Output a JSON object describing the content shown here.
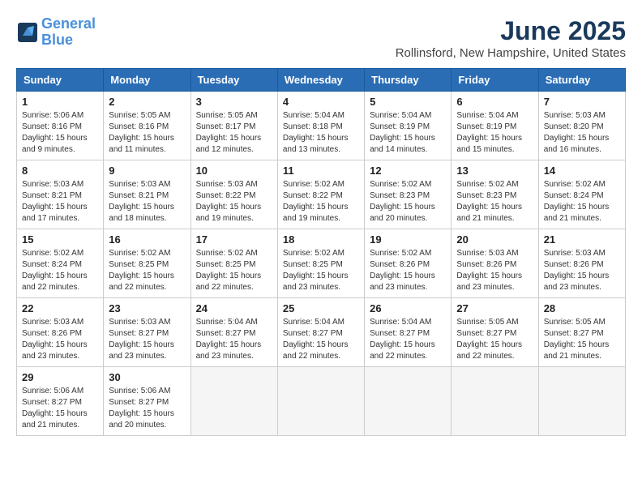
{
  "header": {
    "logo_line1": "General",
    "logo_line2": "Blue",
    "month_title": "June 2025",
    "location": "Rollinsford, New Hampshire, United States"
  },
  "weekdays": [
    "Sunday",
    "Monday",
    "Tuesday",
    "Wednesday",
    "Thursday",
    "Friday",
    "Saturday"
  ],
  "weeks": [
    [
      {
        "day": "1",
        "sunrise": "5:06 AM",
        "sunset": "8:16 PM",
        "daylight": "15 hours and 9 minutes."
      },
      {
        "day": "2",
        "sunrise": "5:05 AM",
        "sunset": "8:16 PM",
        "daylight": "15 hours and 11 minutes."
      },
      {
        "day": "3",
        "sunrise": "5:05 AM",
        "sunset": "8:17 PM",
        "daylight": "15 hours and 12 minutes."
      },
      {
        "day": "4",
        "sunrise": "5:04 AM",
        "sunset": "8:18 PM",
        "daylight": "15 hours and 13 minutes."
      },
      {
        "day": "5",
        "sunrise": "5:04 AM",
        "sunset": "8:19 PM",
        "daylight": "15 hours and 14 minutes."
      },
      {
        "day": "6",
        "sunrise": "5:04 AM",
        "sunset": "8:19 PM",
        "daylight": "15 hours and 15 minutes."
      },
      {
        "day": "7",
        "sunrise": "5:03 AM",
        "sunset": "8:20 PM",
        "daylight": "15 hours and 16 minutes."
      }
    ],
    [
      {
        "day": "8",
        "sunrise": "5:03 AM",
        "sunset": "8:21 PM",
        "daylight": "15 hours and 17 minutes."
      },
      {
        "day": "9",
        "sunrise": "5:03 AM",
        "sunset": "8:21 PM",
        "daylight": "15 hours and 18 minutes."
      },
      {
        "day": "10",
        "sunrise": "5:03 AM",
        "sunset": "8:22 PM",
        "daylight": "15 hours and 19 minutes."
      },
      {
        "day": "11",
        "sunrise": "5:02 AM",
        "sunset": "8:22 PM",
        "daylight": "15 hours and 19 minutes."
      },
      {
        "day": "12",
        "sunrise": "5:02 AM",
        "sunset": "8:23 PM",
        "daylight": "15 hours and 20 minutes."
      },
      {
        "day": "13",
        "sunrise": "5:02 AM",
        "sunset": "8:23 PM",
        "daylight": "15 hours and 21 minutes."
      },
      {
        "day": "14",
        "sunrise": "5:02 AM",
        "sunset": "8:24 PM",
        "daylight": "15 hours and 21 minutes."
      }
    ],
    [
      {
        "day": "15",
        "sunrise": "5:02 AM",
        "sunset": "8:24 PM",
        "daylight": "15 hours and 22 minutes."
      },
      {
        "day": "16",
        "sunrise": "5:02 AM",
        "sunset": "8:25 PM",
        "daylight": "15 hours and 22 minutes."
      },
      {
        "day": "17",
        "sunrise": "5:02 AM",
        "sunset": "8:25 PM",
        "daylight": "15 hours and 22 minutes."
      },
      {
        "day": "18",
        "sunrise": "5:02 AM",
        "sunset": "8:25 PM",
        "daylight": "15 hours and 23 minutes."
      },
      {
        "day": "19",
        "sunrise": "5:02 AM",
        "sunset": "8:26 PM",
        "daylight": "15 hours and 23 minutes."
      },
      {
        "day": "20",
        "sunrise": "5:03 AM",
        "sunset": "8:26 PM",
        "daylight": "15 hours and 23 minutes."
      },
      {
        "day": "21",
        "sunrise": "5:03 AM",
        "sunset": "8:26 PM",
        "daylight": "15 hours and 23 minutes."
      }
    ],
    [
      {
        "day": "22",
        "sunrise": "5:03 AM",
        "sunset": "8:26 PM",
        "daylight": "15 hours and 23 minutes."
      },
      {
        "day": "23",
        "sunrise": "5:03 AM",
        "sunset": "8:27 PM",
        "daylight": "15 hours and 23 minutes."
      },
      {
        "day": "24",
        "sunrise": "5:04 AM",
        "sunset": "8:27 PM",
        "daylight": "15 hours and 23 minutes."
      },
      {
        "day": "25",
        "sunrise": "5:04 AM",
        "sunset": "8:27 PM",
        "daylight": "15 hours and 22 minutes."
      },
      {
        "day": "26",
        "sunrise": "5:04 AM",
        "sunset": "8:27 PM",
        "daylight": "15 hours and 22 minutes."
      },
      {
        "day": "27",
        "sunrise": "5:05 AM",
        "sunset": "8:27 PM",
        "daylight": "15 hours and 22 minutes."
      },
      {
        "day": "28",
        "sunrise": "5:05 AM",
        "sunset": "8:27 PM",
        "daylight": "15 hours and 21 minutes."
      }
    ],
    [
      {
        "day": "29",
        "sunrise": "5:06 AM",
        "sunset": "8:27 PM",
        "daylight": "15 hours and 21 minutes."
      },
      {
        "day": "30",
        "sunrise": "5:06 AM",
        "sunset": "8:27 PM",
        "daylight": "15 hours and 20 minutes."
      },
      null,
      null,
      null,
      null,
      null
    ]
  ]
}
